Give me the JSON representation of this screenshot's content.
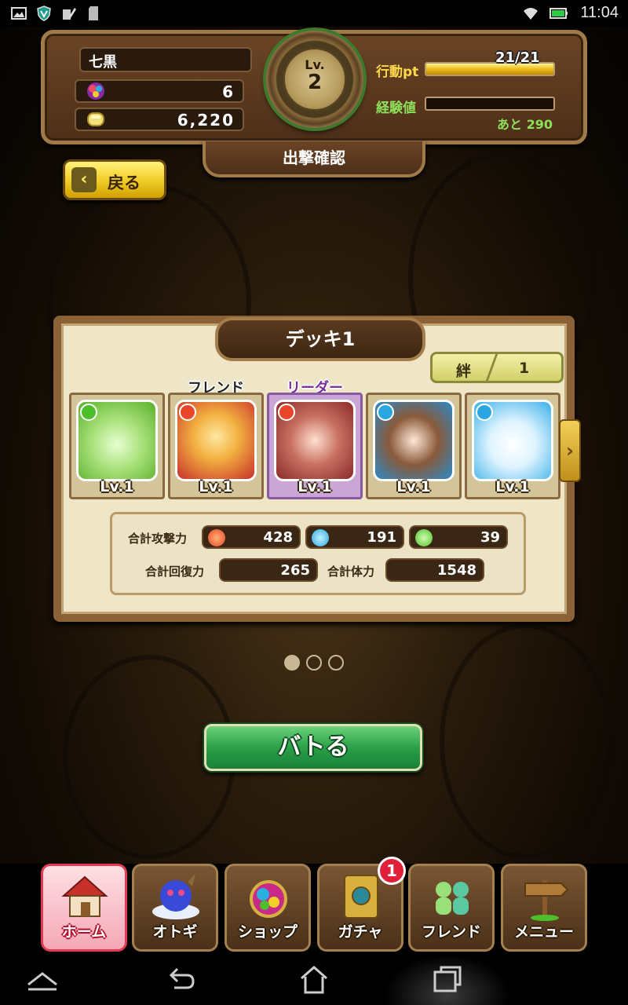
{
  "status_bar": {
    "time": "11:04"
  },
  "player": {
    "name": "七黒",
    "gems": "6",
    "coins": "6,220",
    "level_label": "Lv.",
    "level": "2"
  },
  "action": {
    "label": "行動pt",
    "value_text": "21/21",
    "fill": 1.0
  },
  "experience": {
    "label": "経験値",
    "remaining_text": "あと 290",
    "fill": 0.0
  },
  "screen_title": "出撃確認",
  "back_button": {
    "label": "戻る"
  },
  "deck": {
    "title": "デッキ1",
    "bond_label": "絆",
    "bond_value": "1",
    "friend_tag": "フレンド",
    "leader_tag": "リーダー",
    "cards": [
      {
        "level": "Lv.1",
        "element": "wind",
        "role": ""
      },
      {
        "level": "Lv.1",
        "element": "fire",
        "role": "friend"
      },
      {
        "level": "Lv.1",
        "element": "fire",
        "role": "leader"
      },
      {
        "level": "Lv.1",
        "element": "water",
        "role": ""
      },
      {
        "level": "Lv.1",
        "element": "water",
        "role": ""
      }
    ],
    "stats": {
      "total_attack_label": "合計攻撃力",
      "attack_fire": "428",
      "attack_water": "191",
      "attack_wind": "39",
      "total_recovery_label": "合計回復力",
      "total_recovery": "265",
      "total_hp_label": "合計体力",
      "total_hp": "1548"
    }
  },
  "pager": {
    "pages": 3,
    "current": 1
  },
  "battle_button": {
    "label": "バトる"
  },
  "tabs": [
    {
      "label": "ホーム",
      "active": true
    },
    {
      "label": "オトギ",
      "active": false
    },
    {
      "label": "ショップ",
      "active": false
    },
    {
      "label": "ガチャ",
      "active": false,
      "badge": "1"
    },
    {
      "label": "フレンド",
      "active": false
    },
    {
      "label": "メニュー",
      "active": false
    }
  ],
  "colors": {
    "fire": "#e8452a",
    "water": "#2aa6e0",
    "wind": "#4cbf2a",
    "gold": "#f2cf2a",
    "green_button": "#2aa048"
  }
}
